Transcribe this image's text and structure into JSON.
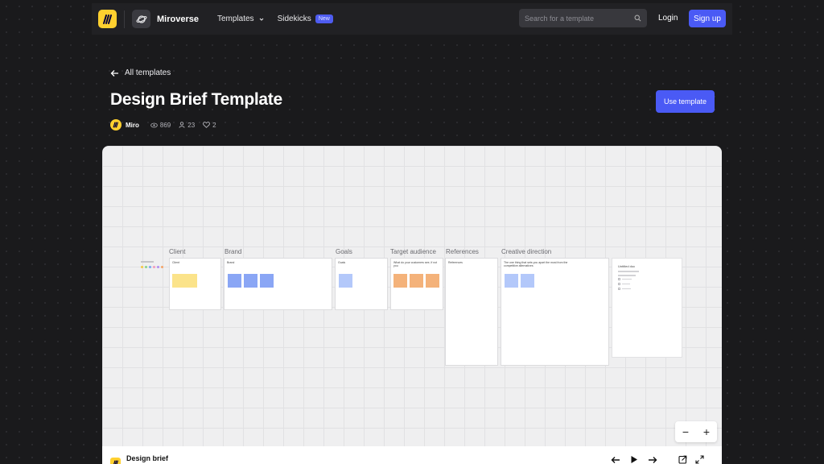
{
  "nav": {
    "brand": "Miroverse",
    "templates_label": "Templates",
    "sidekicks_label": "Sidekicks",
    "sidekicks_badge": "New",
    "search_placeholder": "Search for a template",
    "login_label": "Login",
    "signup_label": "Sign up"
  },
  "header": {
    "back_label": "All templates",
    "title": "Design Brief Template",
    "use_template_label": "Use template",
    "author": "Miro",
    "views": "869",
    "users": "23",
    "likes": "2"
  },
  "board": {
    "columns": [
      {
        "label": "Client",
        "frame_title": "Client"
      },
      {
        "label": "Brand",
        "frame_title": "Brand"
      },
      {
        "label": "Goals",
        "frame_title": "Goals"
      },
      {
        "label": "Target audience",
        "frame_title": "What do your customers see, if not you"
      },
      {
        "label": "References",
        "frame_title": "References"
      },
      {
        "label": "Creative direction",
        "frame_title": "The one thing that sets you apart the most from the competitive alternatives"
      }
    ],
    "doc_title": "Untitled doc",
    "zoom_out": "−",
    "zoom_in": "+",
    "board_title": "Design brief"
  },
  "colors": {
    "accent": "#4a5af5",
    "brand_yellow": "#ffd02f",
    "sticky_yellow": "#fbe38a",
    "sticky_blue": "#8aa6f5",
    "sticky_light_blue": "#b3c8fa",
    "sticky_orange": "#f4b27a"
  },
  "icons": [
    "miro-logo-icon",
    "planet-icon",
    "chevron-down-icon",
    "search-icon",
    "arrow-left-icon",
    "eye-icon",
    "user-icon",
    "heart-icon",
    "play-icon",
    "arrow-right-icon",
    "export-icon",
    "expand-icon"
  ]
}
